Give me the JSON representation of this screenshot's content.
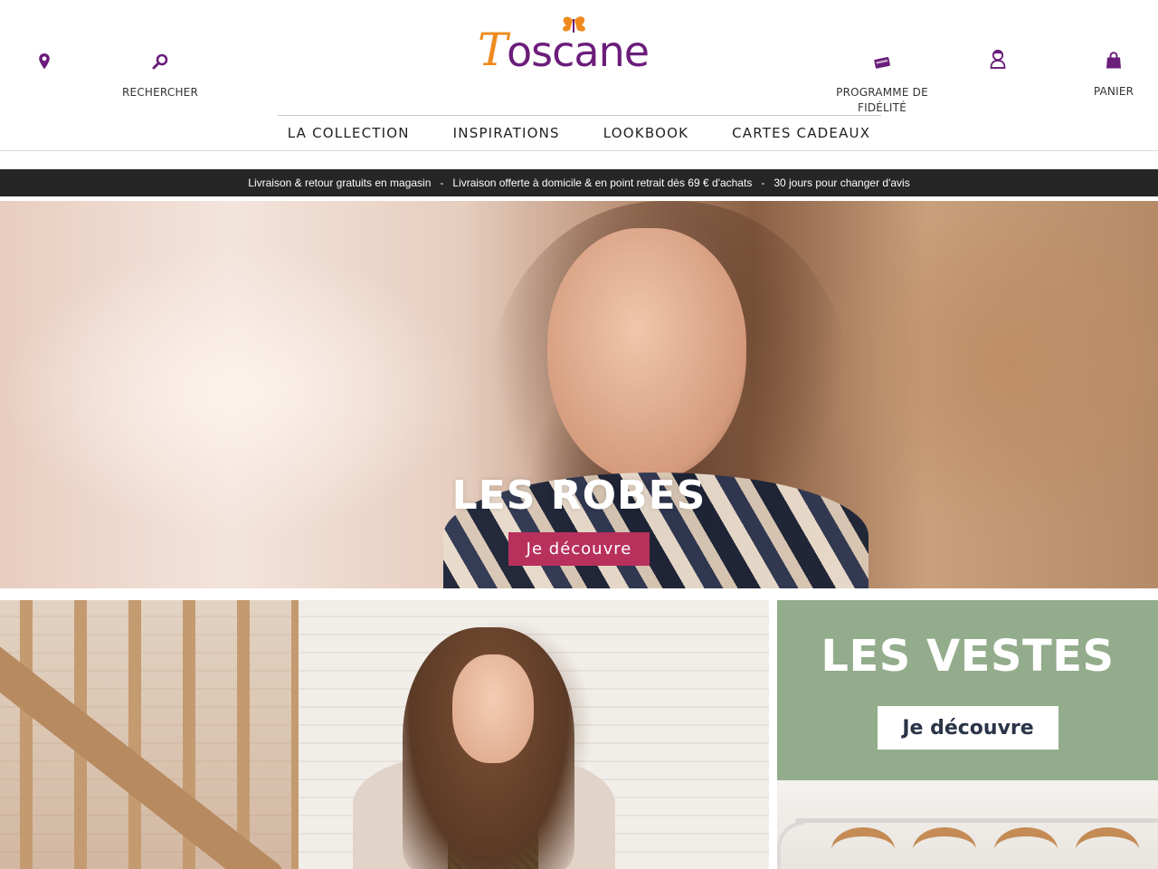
{
  "brand": {
    "logo_text": "Toscane",
    "colors": {
      "primary_purple": "#6b1d7a",
      "accent_orange": "#ef8a1f",
      "hero_button": "#b8315c",
      "promo_bar": "#262626",
      "vestes_panel": "#93ac8b"
    }
  },
  "header": {
    "store_locator": {
      "icon": "map-pin-icon",
      "label": ""
    },
    "search": {
      "icon": "search-icon",
      "label": "RECHERCHER"
    },
    "loyalty": {
      "icon": "loyalty-card-icon",
      "label": "PROGRAMME DE FIDÉLITÉ"
    },
    "account": {
      "icon": "user-icon",
      "label": ""
    },
    "cart": {
      "icon": "shopping-bag-icon",
      "label": "PANIER"
    }
  },
  "nav": {
    "items": [
      {
        "label": "LA COLLECTION"
      },
      {
        "label": "INSPIRATIONS"
      },
      {
        "label": "LOOKBOOK"
      },
      {
        "label": "CARTES CADEAUX"
      }
    ]
  },
  "promo": {
    "messages": [
      "Livraison & retour gratuits en magasin",
      "Livraison offerte à domicile & en point retrait dès 69 € d'achats",
      "30 jours pour changer d'avis"
    ],
    "separator": "-"
  },
  "hero": {
    "title": "LES ROBES",
    "cta": "Je découvre"
  },
  "tiles": {
    "vestes": {
      "title": "LES VESTES",
      "cta": "Je découvre"
    }
  }
}
